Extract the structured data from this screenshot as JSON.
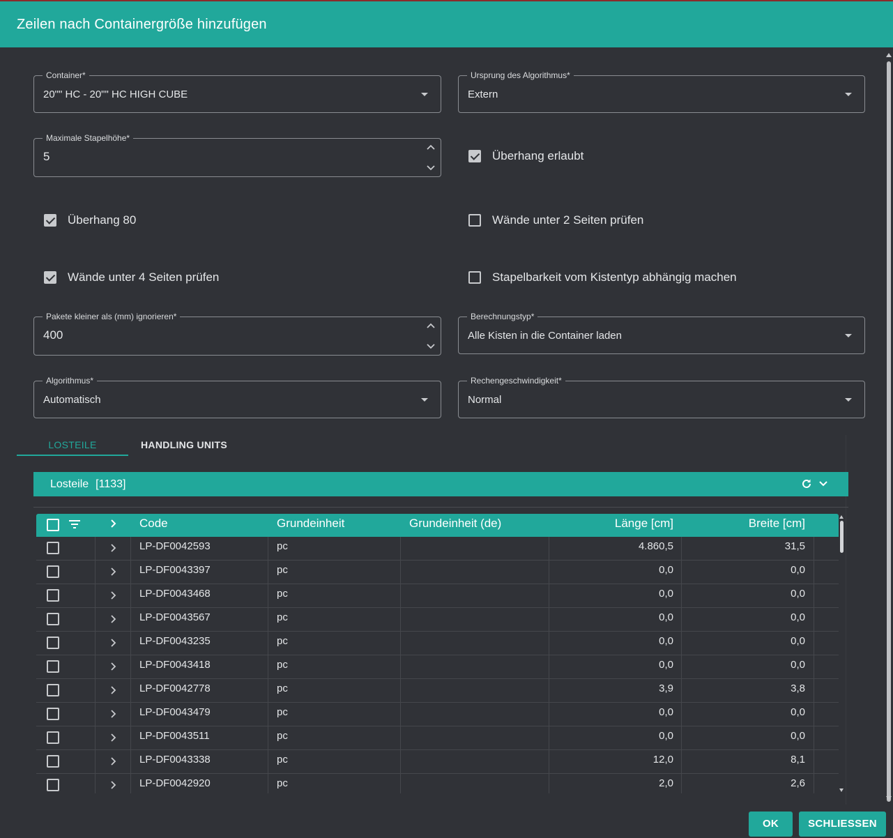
{
  "dialog": {
    "title": "Zeilen nach Containergröße hinzufügen"
  },
  "form": {
    "container": {
      "label": "Container*",
      "value": "20\"\" HC - 20\"\" HC HIGH CUBE"
    },
    "algorithm_origin": {
      "label": "Ursprung des Algorithmus*",
      "value": "Extern"
    },
    "max_stack_height": {
      "label": "Maximale Stapelhöhe*",
      "value": "5"
    },
    "overhang_allowed": {
      "label": "Überhang erlaubt",
      "checked": true
    },
    "overhang_80": {
      "label": "Überhang 80",
      "checked": true
    },
    "walls_2_sides": {
      "label": "Wände unter 2 Seiten prüfen",
      "checked": false
    },
    "walls_4_sides": {
      "label": "Wände unter 4 Seiten prüfen",
      "checked": true
    },
    "stackability_box_type": {
      "label": "Stapelbarkeit vom Kistentyp abhängig machen",
      "checked": false
    },
    "ignore_small_packages": {
      "label": "Pakete kleiner als (mm) ignorieren*",
      "value": "400"
    },
    "calculation_type": {
      "label": "Berechnungstyp*",
      "value": "Alle Kisten in die Container laden"
    },
    "algorithm": {
      "label": "Algorithmus*",
      "value": "Automatisch"
    },
    "calculation_speed": {
      "label": "Rechengeschwindigkeit*",
      "value": "Normal"
    }
  },
  "tabs": [
    {
      "label": "LOSTEILE",
      "active": true
    },
    {
      "label": "HANDLING UNITS",
      "active": false
    }
  ],
  "grid": {
    "title": "Losteile",
    "count": "[1133]",
    "columns": [
      "Code",
      "Grundeinheit",
      "Grundeinheit (de)",
      "Länge [cm]",
      "Breite [cm]"
    ],
    "rows": [
      {
        "code": "LP-DF0042593",
        "unit": "pc",
        "unit_de": "",
        "length": "4.860,5",
        "width": "31,5"
      },
      {
        "code": "LP-DF0043397",
        "unit": "pc",
        "unit_de": "",
        "length": "0,0",
        "width": "0,0"
      },
      {
        "code": "LP-DF0043468",
        "unit": "pc",
        "unit_de": "",
        "length": "0,0",
        "width": "0,0"
      },
      {
        "code": "LP-DF0043567",
        "unit": "pc",
        "unit_de": "",
        "length": "0,0",
        "width": "0,0"
      },
      {
        "code": "LP-DF0043235",
        "unit": "pc",
        "unit_de": "",
        "length": "0,0",
        "width": "0,0"
      },
      {
        "code": "LP-DF0043418",
        "unit": "pc",
        "unit_de": "",
        "length": "0,0",
        "width": "0,0"
      },
      {
        "code": "LP-DF0042778",
        "unit": "pc",
        "unit_de": "",
        "length": "3,9",
        "width": "3,8"
      },
      {
        "code": "LP-DF0043479",
        "unit": "pc",
        "unit_de": "",
        "length": "0,0",
        "width": "0,0"
      },
      {
        "code": "LP-DF0043511",
        "unit": "pc",
        "unit_de": "",
        "length": "0,0",
        "width": "0,0"
      },
      {
        "code": "LP-DF0043338",
        "unit": "pc",
        "unit_de": "",
        "length": "12,0",
        "width": "8,1"
      },
      {
        "code": "LP-DF0042920",
        "unit": "pc",
        "unit_de": "",
        "length": "2,0",
        "width": "2,6"
      }
    ]
  },
  "footer": {
    "ok_label": "OK",
    "close_label": "SCHLIESSEN"
  },
  "colors": {
    "accent": "#21a89b",
    "background": "#303237"
  }
}
